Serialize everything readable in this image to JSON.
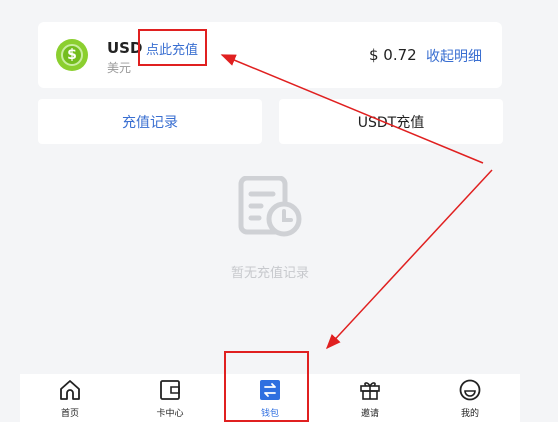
{
  "balance": {
    "currency_code": "USD",
    "coin_symbol": "$",
    "recharge_link": "点此充值",
    "currency_name": "美元",
    "amount": "$ 0.72",
    "collapse_link": "收起明细"
  },
  "tabs": {
    "left": "充值记录",
    "right": "USDT充值"
  },
  "empty_state": {
    "text": "暂无充值记录",
    "icon": "document-clock-icon"
  },
  "bottom_nav": [
    {
      "label": "首页",
      "icon": "home-icon"
    },
    {
      "label": "卡中心",
      "icon": "wallet-card-icon"
    },
    {
      "label": "钱包",
      "icon": "exchange-icon",
      "active": true
    },
    {
      "label": "邀请",
      "icon": "gift-icon"
    },
    {
      "label": "我的",
      "icon": "smile-icon"
    }
  ],
  "colors": {
    "accent": "#2f6fe0",
    "link": "#3a6fd1",
    "annotation": "#e02020",
    "coin": "#8bcf2f"
  }
}
